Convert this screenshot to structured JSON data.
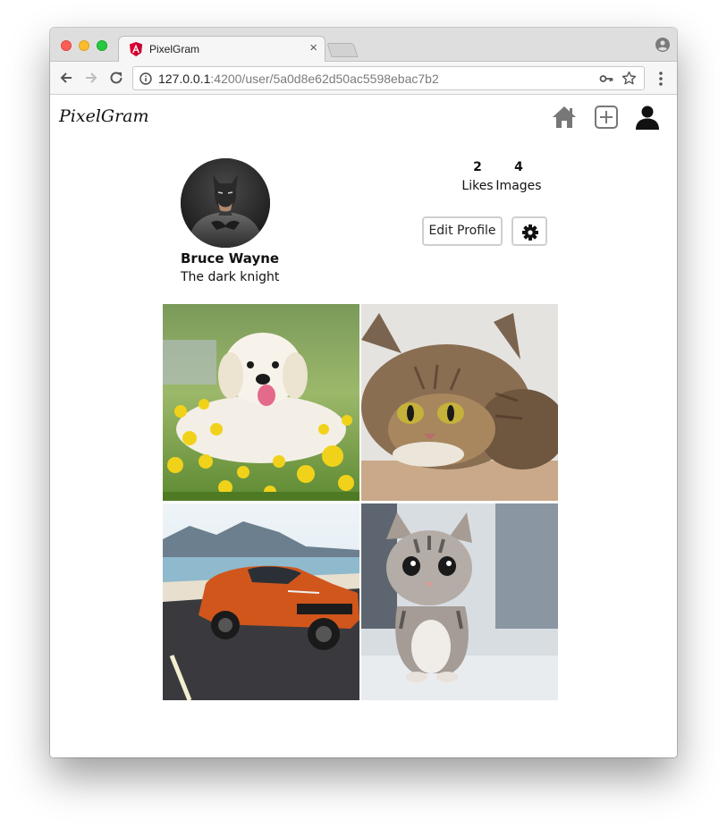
{
  "browser": {
    "tab_title": "PixelGram",
    "tab_close": "×",
    "url_host": "127.0.0.1",
    "url_rest": ":4200/user/5a0d8e62d50ac5598ebac7b2"
  },
  "app": {
    "logo": "PixelGram",
    "nav": {
      "home_icon": "home-icon",
      "add_icon": "add-square-icon",
      "profile_icon": "user-icon"
    }
  },
  "profile": {
    "name": "Bruce Wayne",
    "bio": "The dark knight",
    "avatar_icon": "batman-avatar",
    "likes_count": "2",
    "likes_label": "Likes",
    "images_count": "4",
    "images_label": "Images",
    "edit_label": "Edit Profile",
    "settings_icon": "gear-icon"
  },
  "images": [
    {
      "subject": "golden retriever in flowers"
    },
    {
      "subject": "tabby cat lying down"
    },
    {
      "subject": "orange sports car on coastal road"
    },
    {
      "subject": "tabby kitten sitting"
    }
  ],
  "colors": {
    "window_bg": "#ffffff",
    "titlebar": "#dedede",
    "button_border": "#cfcfcf"
  }
}
